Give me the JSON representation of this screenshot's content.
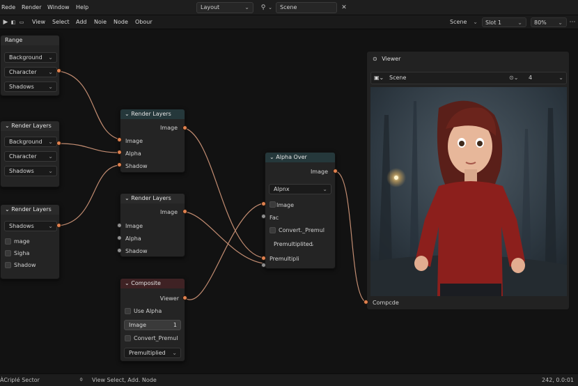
{
  "topbar": {
    "menus": [
      "Rede",
      "Render",
      "Window",
      "Help"
    ],
    "workspace": "Layout",
    "scene": "Scene"
  },
  "toolbar": {
    "menus": [
      "View",
      "Select",
      "Add",
      "Noie",
      "Node",
      "Obour"
    ],
    "scene": "Scene",
    "slot": "Slot 1",
    "zoom": "80%"
  },
  "range_panel": {
    "title": "Range",
    "items": [
      "Background",
      "Character",
      "Shadows"
    ]
  },
  "render_layers_panel_1": {
    "title": "Render Layers",
    "items": [
      "Background",
      "Character",
      "Shadows"
    ]
  },
  "render_layers_panel_2": {
    "title": "Render Layers",
    "select": "Shadows",
    "checks": [
      "mage",
      "Sigha",
      "Shadow"
    ]
  },
  "render_layers_node_1": {
    "title": "Render Layers",
    "output": "Image",
    "inputs": [
      "Image",
      "Alpha",
      "Shadow"
    ]
  },
  "render_layers_node_2": {
    "title": "Render Layers",
    "output": "Image",
    "inputs": [
      "Image",
      "Alpha",
      "Shadow"
    ]
  },
  "composite_node": {
    "title": "Composite",
    "output": "Viewer",
    "use_alpha": "Use Alpha",
    "image_label": "Image",
    "image_value": "1",
    "convert": "Convert_Premul",
    "mode": "Premultiplied"
  },
  "alpha_over_node": {
    "title": "Alpha Over",
    "output": "Image",
    "select": "Alpnx",
    "image_input": "Image",
    "fac": "Fac",
    "convert": "Convert._Premul",
    "mode": "Premultiplited",
    "premult": "Premultipli"
  },
  "viewer": {
    "title": "Viewer",
    "scene": "Scene",
    "count": "4",
    "input": "Compcde"
  },
  "statusbar": {
    "left": "ÀCriplé Sector",
    "middle": "View Select, Add. Node",
    "right": "242, 0.0:01"
  },
  "colors": {
    "socket_orange": "#e0814f",
    "link": "#d99a7a",
    "teal_header": "#25383b",
    "red_header": "#3f2224"
  }
}
